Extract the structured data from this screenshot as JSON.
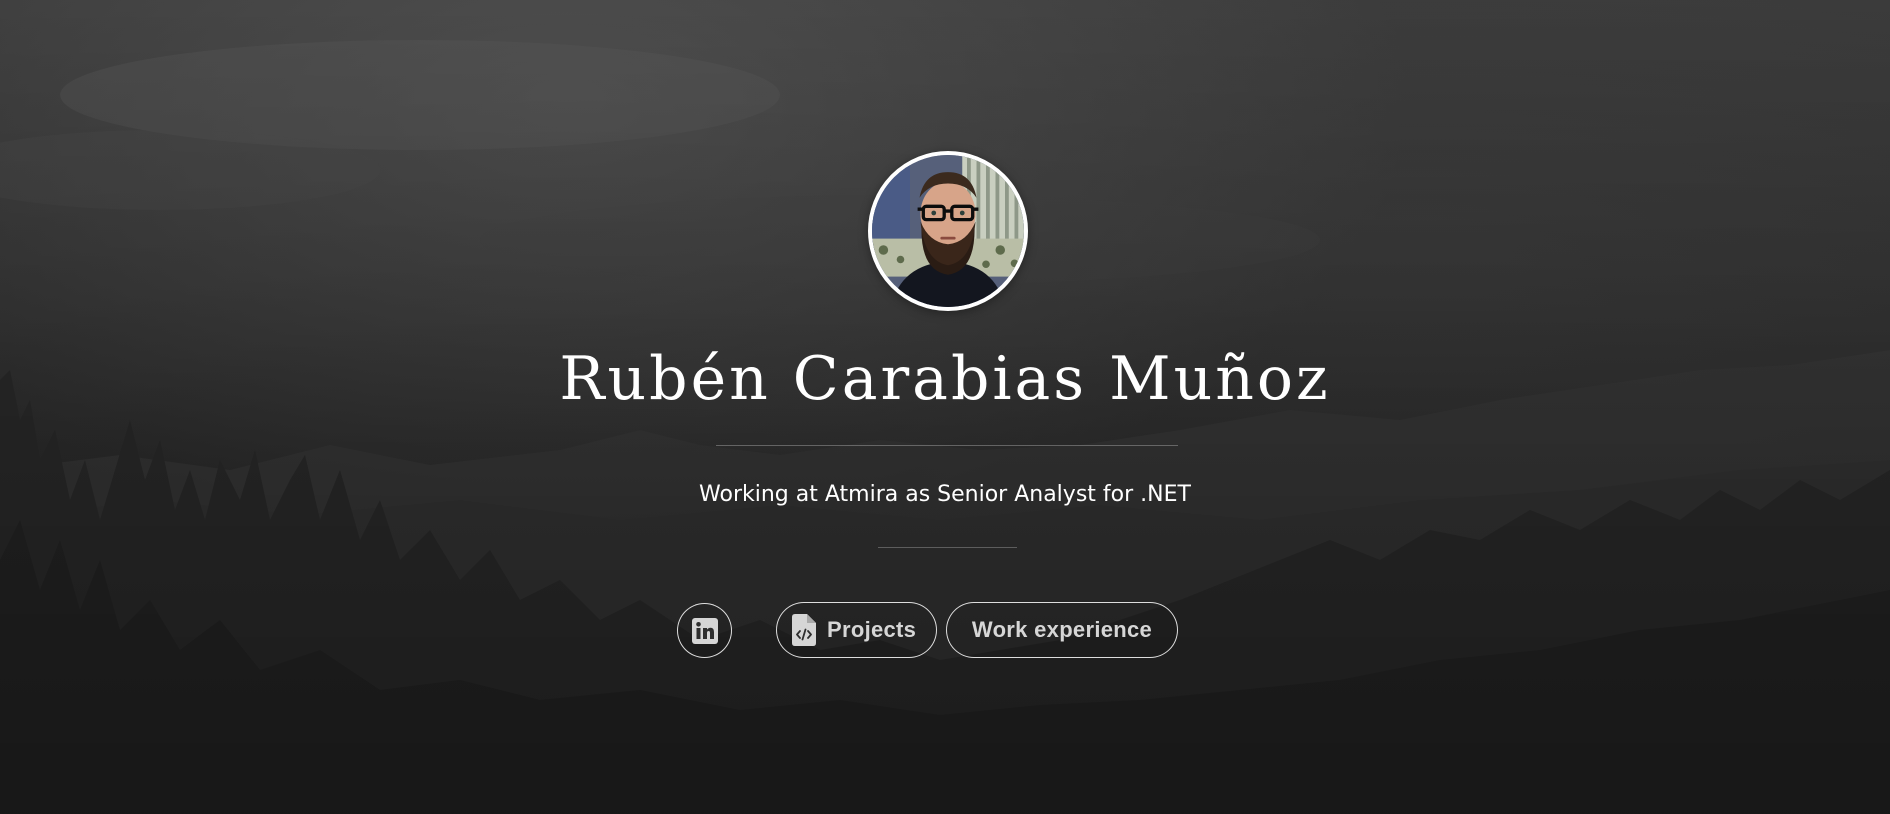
{
  "profile": {
    "name": "Rubén Carabias Muñoz",
    "tagline": "Working at Atmira as Senior Analyst for .NET"
  },
  "buttons": {
    "linkedin_icon": "linkedin-icon",
    "projects_label": "Projects",
    "projects_icon": "file-code-icon",
    "work_label": "Work experience"
  },
  "colors": {
    "text": "#ffffff",
    "button_text": "#d6d6d6",
    "background": "#2e2e2e"
  }
}
